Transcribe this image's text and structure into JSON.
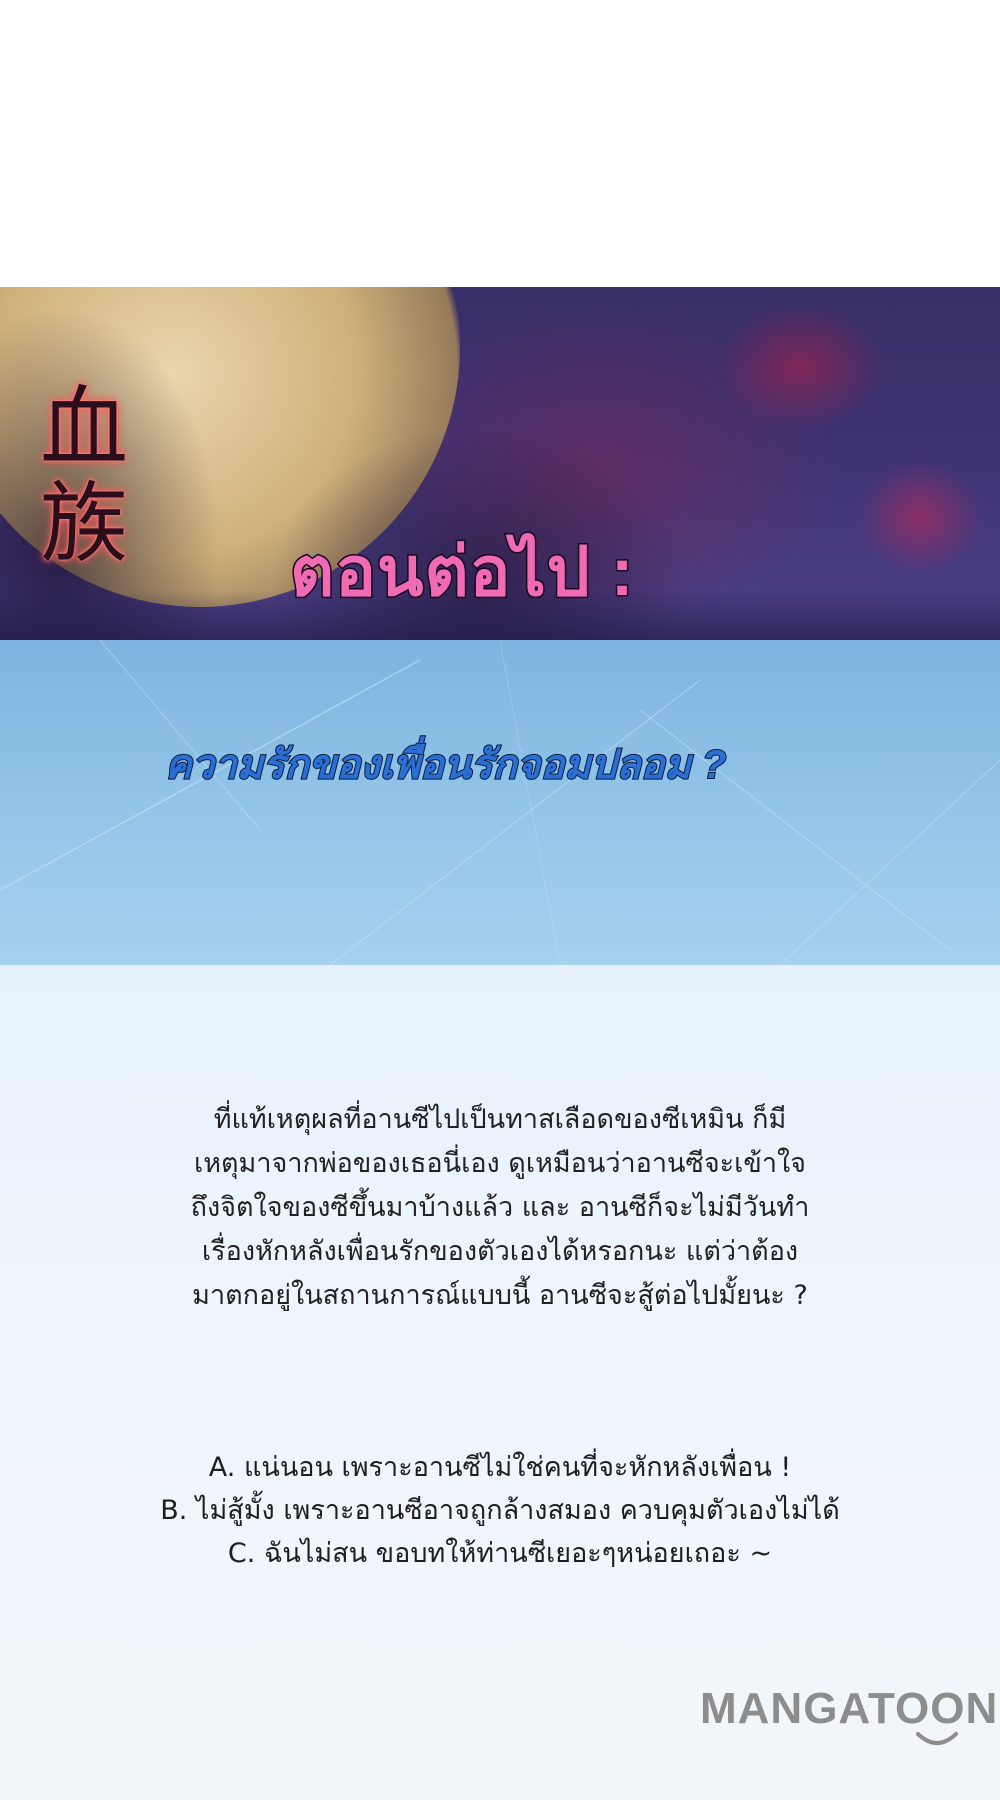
{
  "banner": {
    "logo_chars": [
      "血",
      "族"
    ],
    "next_title": "ตอนต่อไป :"
  },
  "subtitle": "ความรักของเพื่อนรักจอมปลอม ?",
  "story": [
    "ที่แท้เหตุผลที่อานซีไปเป็นทาสเลือดของซีเหมิน ก็มี",
    "เหตุมาจากพ่อของเธอนี่เอง ดูเหมือนว่าอานซีจะเข้าใจ",
    "ถึงจิตใจของซีขึ้นมาบ้างแล้ว และ อานซีก็จะไม่มีวันทำ",
    "เรื่องหักหลังเพื่อนรักของตัวเองได้หรอกนะ แต่ว่าต้อง",
    "มาตกอยู่ในสถานการณ์แบบนี้ อานซีจะสู้ต่อไปมั้ยนะ ?"
  ],
  "options": [
    "A. แน่นอน เพราะอานซีไม่ใช่คนที่จะหักหลังเพื่อน !",
    "B. ไม่สู้มั้ง เพราะอานซีอาจถูกล้างสมอง ควบคุมตัวเองไม่ได้",
    "C. ฉันไม่สน ขอบทให้ท่านซีเยอะๆหน่อยเถอะ ~"
  ],
  "watermark": "MANGATOON",
  "colors": {
    "next_title": "#f06bb4",
    "subtitle": "#2a6fd6",
    "logo_glow": "#ff6a6a",
    "watermark": "#8d8d8d"
  }
}
